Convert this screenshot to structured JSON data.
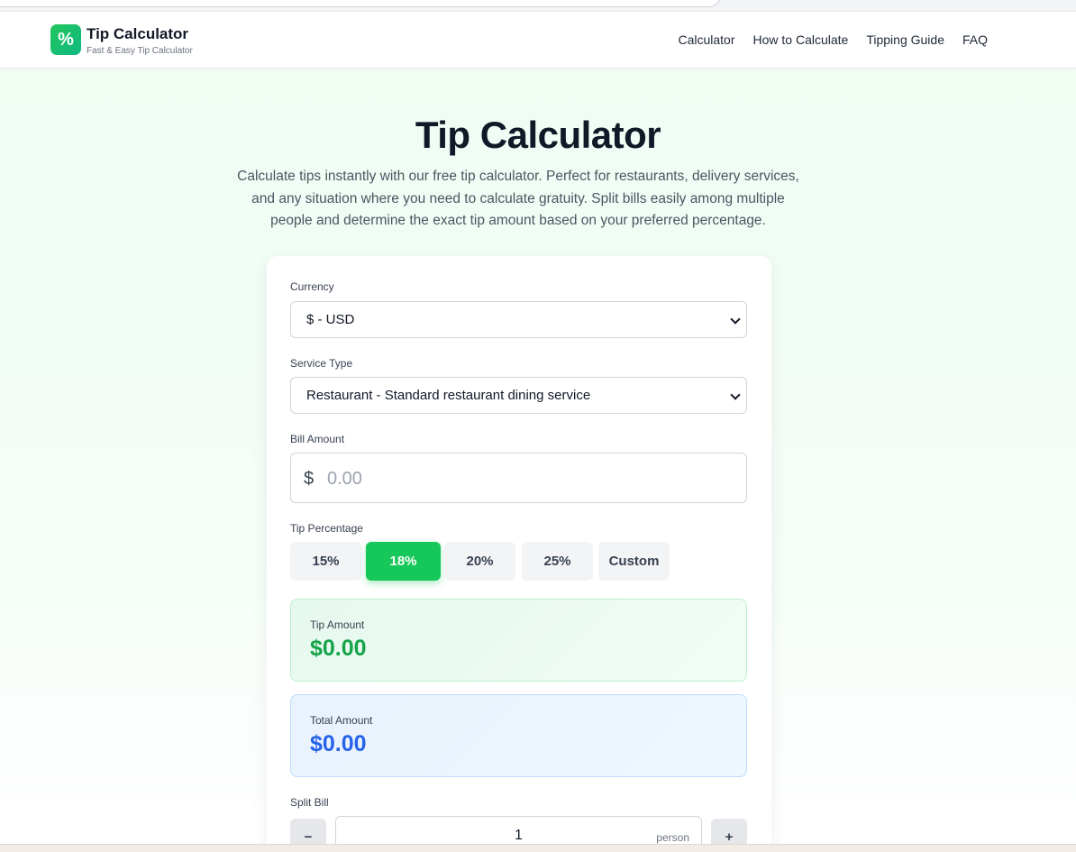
{
  "header": {
    "brand_title": "Tip Calculator",
    "brand_subtitle": "Fast & Easy Tip Calculator",
    "logo_symbol": "%",
    "nav": [
      {
        "label": "Calculator"
      },
      {
        "label": "How to Calculate"
      },
      {
        "label": "Tipping Guide"
      },
      {
        "label": "FAQ"
      }
    ]
  },
  "hero": {
    "title": "Tip Calculator",
    "intro": "Calculate tips instantly with our free tip calculator. Perfect for restaurants, delivery services, and any situation where you need to calculate gratuity. Split bills easily among multiple people and determine the exact tip amount based on your preferred percentage."
  },
  "form": {
    "currency": {
      "label": "Currency",
      "value": "$ - USD"
    },
    "service_type": {
      "label": "Service Type",
      "value": "Restaurant - Standard restaurant dining service"
    },
    "bill_amount": {
      "label": "Bill Amount",
      "currency_symbol": "$",
      "placeholder": "0.00"
    },
    "tip_percentage": {
      "label": "Tip Percentage",
      "options": [
        {
          "label": "15%"
        },
        {
          "label": "18%",
          "selected": true
        },
        {
          "label": "20%"
        },
        {
          "label": "25%"
        },
        {
          "label": "Custom"
        }
      ]
    },
    "tip_amount": {
      "label": "Tip Amount",
      "value": "$0.00"
    },
    "total_amount": {
      "label": "Total Amount",
      "value": "$0.00"
    },
    "split_bill": {
      "label": "Split Bill",
      "decrement": "−",
      "increment": "+",
      "value": "1",
      "unit": "person"
    }
  },
  "colors": {
    "accent_green": "#16c75a",
    "tip_value": "#16a34a",
    "total_value": "#2563eb"
  }
}
